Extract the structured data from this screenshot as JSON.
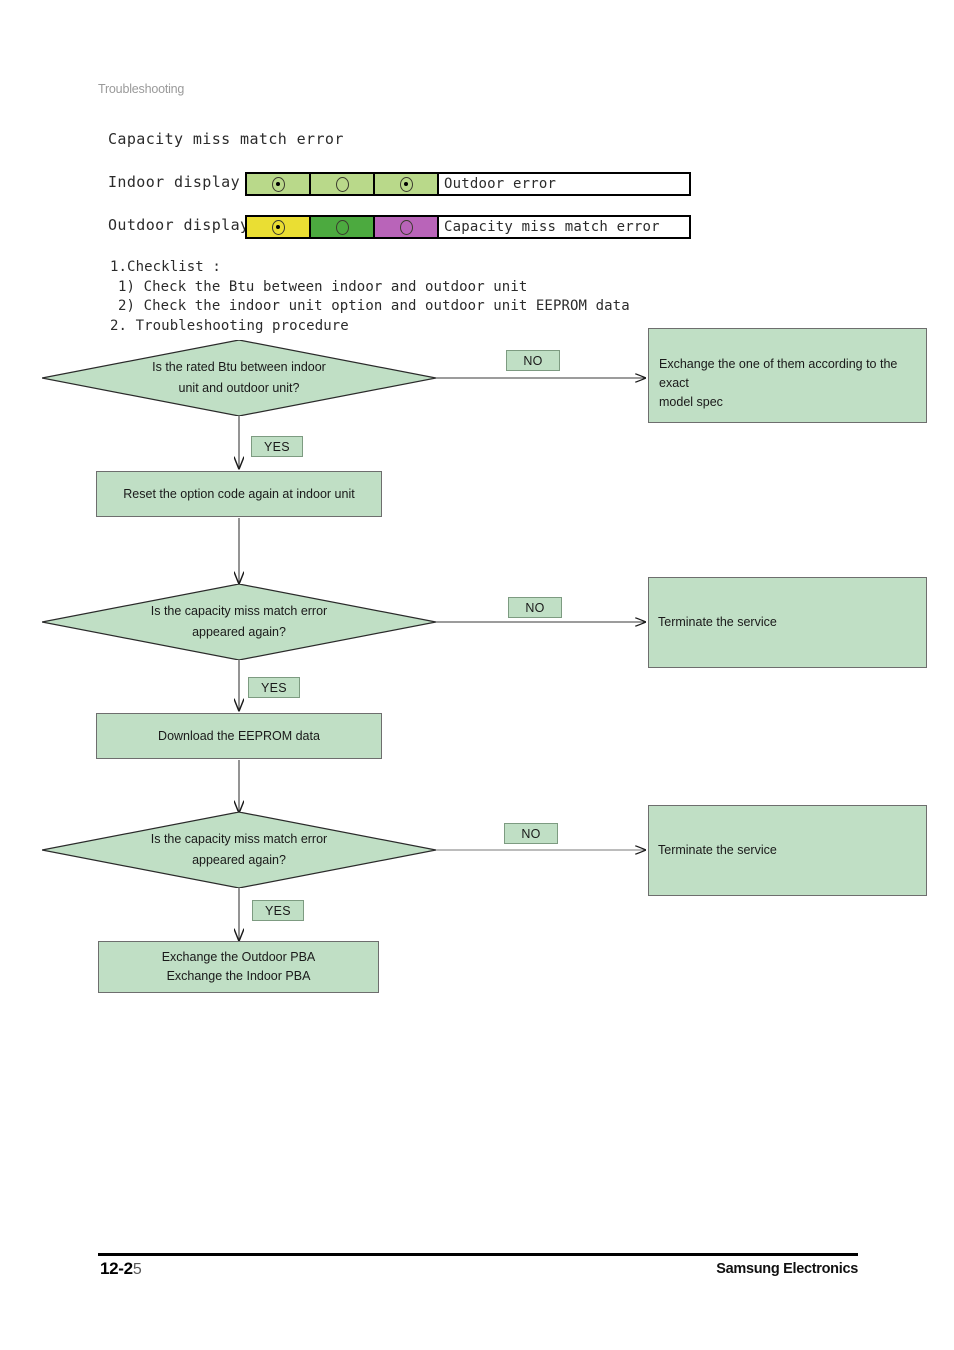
{
  "header": {
    "section": "Troubleshooting"
  },
  "error_title": "Capacity miss match error",
  "displays": [
    {
      "label": "Indoor display",
      "message": "Outdoor error",
      "leds": [
        {
          "color": "#b9d98a",
          "state": "on"
        },
        {
          "color": "#b9d98a",
          "state": "off"
        },
        {
          "color": "#b9d98a",
          "state": "on"
        }
      ]
    },
    {
      "label": "Outdoor display",
      "message": "Capacity miss match error",
      "leds": [
        {
          "color": "#eade33",
          "state": "on"
        },
        {
          "color": "#4caa3f",
          "state": "off"
        },
        {
          "color": "#b964b9",
          "state": "off"
        }
      ]
    }
  ],
  "checklist": {
    "line1": "1.Checklist :",
    "line2": "1) Check the Btu between indoor and outdoor unit",
    "line3": "2) Check the indoor unit option and outdoor unit EEPROM data",
    "line4": "2. Troubleshooting procedure"
  },
  "flow": {
    "decision1_line1": "Is the rated Btu between indoor",
    "decision1_line2": "unit and outdoor unit?",
    "decision1_no_label": "NO",
    "decision1_yes_label": "YES",
    "result1_line1": "Exchange the one of them according to the exact",
    "result1_line2": "model spec",
    "process1": "Reset the option code again at indoor unit",
    "decision2_line1": "Is the capacity miss match error",
    "decision2_line2": "appeared again?",
    "decision2_no_label": "NO",
    "decision2_yes_label": "YES",
    "result2": "Terminate the service",
    "process2": "Download the EEPROM data",
    "decision3_line1": "Is the capacity miss match error",
    "decision3_line2": "appeared again?",
    "decision3_no_label": "NO",
    "decision3_yes_label": "YES",
    "result3": "Terminate the service",
    "final_line1": "Exchange the  Outdoor PBA",
    "final_line2": "Exchange the Indoor PBA"
  },
  "footer": {
    "page_main": "12-2",
    "page_suffix": "5",
    "brand": "Samsung Electronics"
  },
  "colors": {
    "node_fill": "#c0dfc5",
    "node_border": "#6e6e6e",
    "led_green": "#b9d98a",
    "led_yellow": "#eade33",
    "led_solid_green": "#4caa3f",
    "led_purple": "#b964b9"
  }
}
